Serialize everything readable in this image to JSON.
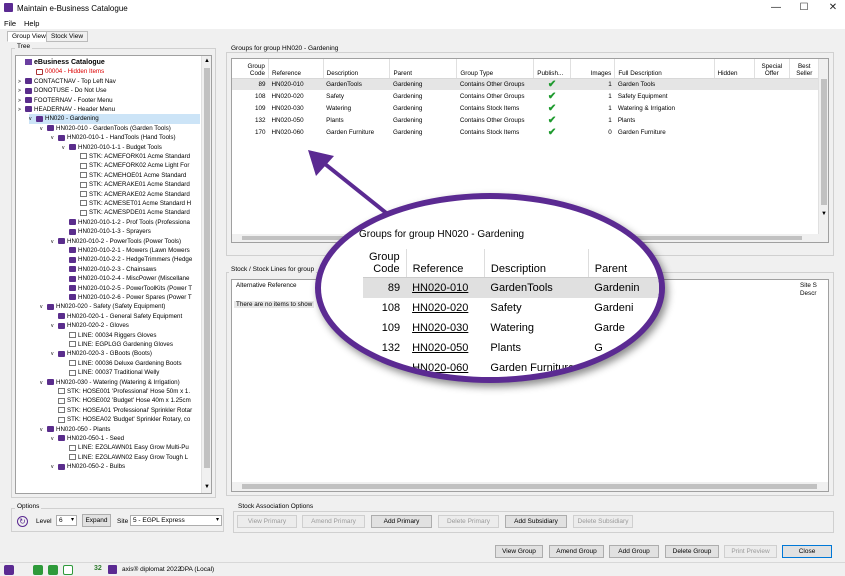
{
  "window": {
    "title": "Maintain e-Business Catalogue",
    "controls": {
      "minimize": "—",
      "maximize": "☐",
      "close": "✕"
    }
  },
  "menu": {
    "file": "File",
    "help": "Help"
  },
  "tabs": [
    "Group View",
    "Stock View"
  ],
  "tree": {
    "legend": "Tree",
    "items": [
      {
        "label": "eBusiness Catalogue",
        "indent": 0,
        "type": "root",
        "expander": ""
      },
      {
        "label": "00004 - Hidden Items",
        "indent": 1,
        "type": "hidden",
        "expander": ""
      },
      {
        "label": "CONTACTNAV - Top Left Nav",
        "indent": 0,
        "type": "folder",
        "expander": ">"
      },
      {
        "label": "DONOTUSE - Do Not Use",
        "indent": 0,
        "type": "folder",
        "expander": ">"
      },
      {
        "label": "FOOTERNAV - Footer Menu",
        "indent": 0,
        "type": "folder",
        "expander": ">"
      },
      {
        "label": "HEADERNAV - Header Menu",
        "indent": 0,
        "type": "folder",
        "expander": ">"
      },
      {
        "label": "HN020 - Gardening",
        "indent": 1,
        "type": "folder",
        "expander": "v",
        "selected": true
      },
      {
        "label": "HN020-010 - GardenTools (Garden Tools)",
        "indent": 2,
        "type": "folder",
        "expander": "v"
      },
      {
        "label": "HN020-010-1 - HandTools (Hand Tools)",
        "indent": 3,
        "type": "folder",
        "expander": "v"
      },
      {
        "label": "HN020-010-1-1 - Budget Tools",
        "indent": 4,
        "type": "folder",
        "expander": "v"
      },
      {
        "label": "STK: ACMEFORK01 Acme Standard",
        "indent": 5,
        "type": "item",
        "expander": ""
      },
      {
        "label": "STK: ACMEFORK02 Acme Light For",
        "indent": 5,
        "type": "item",
        "expander": ""
      },
      {
        "label": "STK: ACMEHOE01 Acme Standard",
        "indent": 5,
        "type": "item",
        "expander": ""
      },
      {
        "label": "STK: ACMERAKE01 Acme Standard",
        "indent": 5,
        "type": "item",
        "expander": ""
      },
      {
        "label": "STK: ACMERAKE02 Acme Standard",
        "indent": 5,
        "type": "item",
        "expander": ""
      },
      {
        "label": "STK: ACMESET01 Acme Standard H",
        "indent": 5,
        "type": "item",
        "expander": ""
      },
      {
        "label": "STK: ACMESPDE01 Acme Standard",
        "indent": 5,
        "type": "item",
        "expander": ""
      },
      {
        "label": "HN020-010-1-2 - Prof Tools (Professiona",
        "indent": 4,
        "type": "folder",
        "expander": ""
      },
      {
        "label": "HN020-010-1-3 - Sprayers",
        "indent": 4,
        "type": "folder",
        "expander": ""
      },
      {
        "label": "HN020-010-2 - PowerTools (Power Tools)",
        "indent": 3,
        "type": "folder",
        "expander": "v"
      },
      {
        "label": "HN020-010-2-1 - Mowers (Lawn Mowers",
        "indent": 4,
        "type": "folder",
        "expander": ""
      },
      {
        "label": "HN020-010-2-2 - HedgeTrimmers (Hedge",
        "indent": 4,
        "type": "folder",
        "expander": ""
      },
      {
        "label": "HN020-010-2-3 - Chainsaws",
        "indent": 4,
        "type": "folder",
        "expander": ""
      },
      {
        "label": "HN020-010-2-4 - MiscPower (Miscellane",
        "indent": 4,
        "type": "folder",
        "expander": ""
      },
      {
        "label": "HN020-010-2-5 - PowerToolKits (Power T",
        "indent": 4,
        "type": "folder",
        "expander": ""
      },
      {
        "label": "HN020-010-2-6 - Power Spares (Power T",
        "indent": 4,
        "type": "folder",
        "expander": ""
      },
      {
        "label": "HN020-020 - Safety (Safety Equipment)",
        "indent": 2,
        "type": "folder",
        "expander": "v"
      },
      {
        "label": "HN020-020-1 - General Safety Equipment",
        "indent": 3,
        "type": "folder",
        "expander": ""
      },
      {
        "label": "HN020-020-2 - Gloves",
        "indent": 3,
        "type": "folder",
        "expander": "v"
      },
      {
        "label": "LINE: 00034 Riggers Gloves",
        "indent": 4,
        "type": "item",
        "expander": ""
      },
      {
        "label": "LINE: EGPLGG Gardening Gloves",
        "indent": 4,
        "type": "item",
        "expander": ""
      },
      {
        "label": "HN020-020-3 - GBoots (Boots)",
        "indent": 3,
        "type": "folder",
        "expander": "v"
      },
      {
        "label": "LINE: 00036 Deluxe Gardening Boots",
        "indent": 4,
        "type": "item",
        "expander": ""
      },
      {
        "label": "LINE: 00037 Traditional Welly",
        "indent": 4,
        "type": "item",
        "expander": ""
      },
      {
        "label": "HN020-030 - Watering (Watering & Irrigation)",
        "indent": 2,
        "type": "folder",
        "expander": "v"
      },
      {
        "label": "STK: HOSE001 'Professional' Hose 50m x 1.",
        "indent": 3,
        "type": "item",
        "expander": ""
      },
      {
        "label": "STK: HOSE002 'Budget' Hose 40m x 1.25cm",
        "indent": 3,
        "type": "item",
        "expander": ""
      },
      {
        "label": "STK: HOSEA01 'Professional' Sprinkler Rotar",
        "indent": 3,
        "type": "item",
        "expander": ""
      },
      {
        "label": "STK: HOSEA02 'Budget' Sprinkler Rotary, co",
        "indent": 3,
        "type": "item",
        "expander": ""
      },
      {
        "label": "HN020-050 - Plants",
        "indent": 2,
        "type": "folder",
        "expander": "v"
      },
      {
        "label": "HN020-050-1 - Seed",
        "indent": 3,
        "type": "folder",
        "expander": "v"
      },
      {
        "label": "LINE: EZGLAWN01 Easy Grow Multi-Pu",
        "indent": 4,
        "type": "item",
        "expander": ""
      },
      {
        "label": "LINE: EZGLAWN02 Easy Grow Tough L",
        "indent": 4,
        "type": "item",
        "expander": ""
      },
      {
        "label": "HN020-050-2 - Bulbs",
        "indent": 3,
        "type": "folder",
        "expander": "v"
      }
    ]
  },
  "groups": {
    "legend": "Groups for group HN020 - Gardening",
    "columns": [
      "Group Code",
      "Reference",
      "Description",
      "Parent",
      "Group Type",
      "Publish...",
      "Images",
      "Full Description",
      "Hidden",
      "Special Offer",
      "Best Seller"
    ],
    "rows": [
      {
        "code": "89",
        "ref": "HN020-010",
        "desc": "GardenTools",
        "parent": "Gardening",
        "type": "Contains Other Groups",
        "publish": "✔",
        "images": "1",
        "full": "Garden Tools"
      },
      {
        "code": "108",
        "ref": "HN020-020",
        "desc": "Safety",
        "parent": "Gardening",
        "type": "Contains Other Groups",
        "publish": "✔",
        "images": "1",
        "full": "Safety Equipment"
      },
      {
        "code": "109",
        "ref": "HN020-030",
        "desc": "Watering",
        "parent": "Gardening",
        "type": "Contains Stock Items",
        "publish": "✔",
        "images": "1",
        "full": "Watering & Irrigation"
      },
      {
        "code": "132",
        "ref": "HN020-050",
        "desc": "Plants",
        "parent": "Gardening",
        "type": "Contains Other Groups",
        "publish": "✔",
        "images": "1",
        "full": "Plants"
      },
      {
        "code": "170",
        "ref": "HN020-060",
        "desc": "Garden Furniture",
        "parent": "Gardening",
        "type": "Contains Stock Items",
        "publish": "✔",
        "images": "0",
        "full": "Garden Furniture"
      }
    ]
  },
  "stock": {
    "legend": "Stock / Stock Lines for group",
    "col_alt": "Alternative Reference",
    "col_site": "Site S Descr",
    "empty": "There are no items to show"
  },
  "magnifier": {
    "title": "Groups for group HN020 - Gardening",
    "columns": [
      "Group Code",
      "Reference",
      "Description",
      "Parent"
    ],
    "rows": [
      {
        "code": "89",
        "ref": "HN020-010",
        "desc": "GardenTools",
        "parent": "Gardenin"
      },
      {
        "code": "108",
        "ref": "HN020-020",
        "desc": "Safety",
        "parent": "Gardeni"
      },
      {
        "code": "109",
        "ref": "HN020-030",
        "desc": "Watering",
        "parent": "Garde"
      },
      {
        "code": "132",
        "ref": "HN020-050",
        "desc": "Plants",
        "parent": "G"
      },
      {
        "code": "170",
        "ref": "HN020-060",
        "desc": "Garden Furniture",
        "parent": ""
      }
    ]
  },
  "options": {
    "legend": "Options",
    "level_label": "Level",
    "level_value": "6",
    "expand": "Expand",
    "site_label": "Site",
    "site_value": "5 - EGPL Express"
  },
  "stock_assoc": {
    "legend": "Stock Association Options",
    "buttons": [
      "View Primary",
      "Amend Primary",
      "Add Primary",
      "Delete Primary",
      "Add Subsidiary",
      "Delete Subsidiary"
    ]
  },
  "actions": [
    "View Group",
    "Amend Group",
    "Add Group",
    "Delete Group",
    "Print Preview",
    "Close"
  ],
  "status": {
    "count": "32",
    "product": "axis® diplomat 2022",
    "db": "DPA (Local)"
  },
  "colors": {
    "accent": "#5b2a92",
    "check": "#1e9a2e",
    "selection": "#cce4f7"
  }
}
